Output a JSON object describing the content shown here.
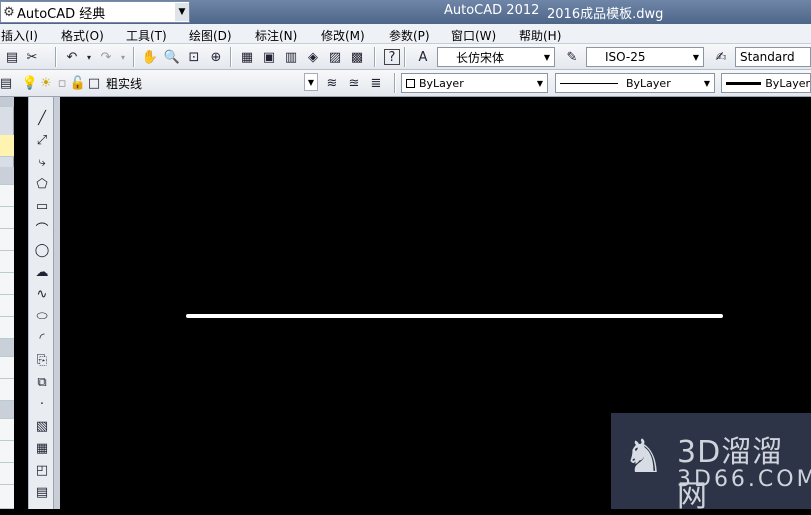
{
  "titlebar": {
    "workspace": "AutoCAD 经典",
    "app": "AutoCAD 2012",
    "document": "2016成品模板.dwg"
  },
  "menus": [
    "插入(I)",
    "格式(O)",
    "工具(T)",
    "绘图(D)",
    "标注(N)",
    "修改(M)",
    "参数(P)",
    "窗口(W)",
    "帮助(H)"
  ],
  "toolbar1": {
    "text_style": "长仿宋体",
    "dim_style": "ISO-25",
    "table_style": "Standard"
  },
  "toolbar2": {
    "layer": "粗实线",
    "color": "ByLayer",
    "linetype": "ByLayer",
    "lineweight": "ByLayer"
  },
  "watermark": {
    "line1": "3D溜溜网",
    "line2": "3D66.COM"
  }
}
